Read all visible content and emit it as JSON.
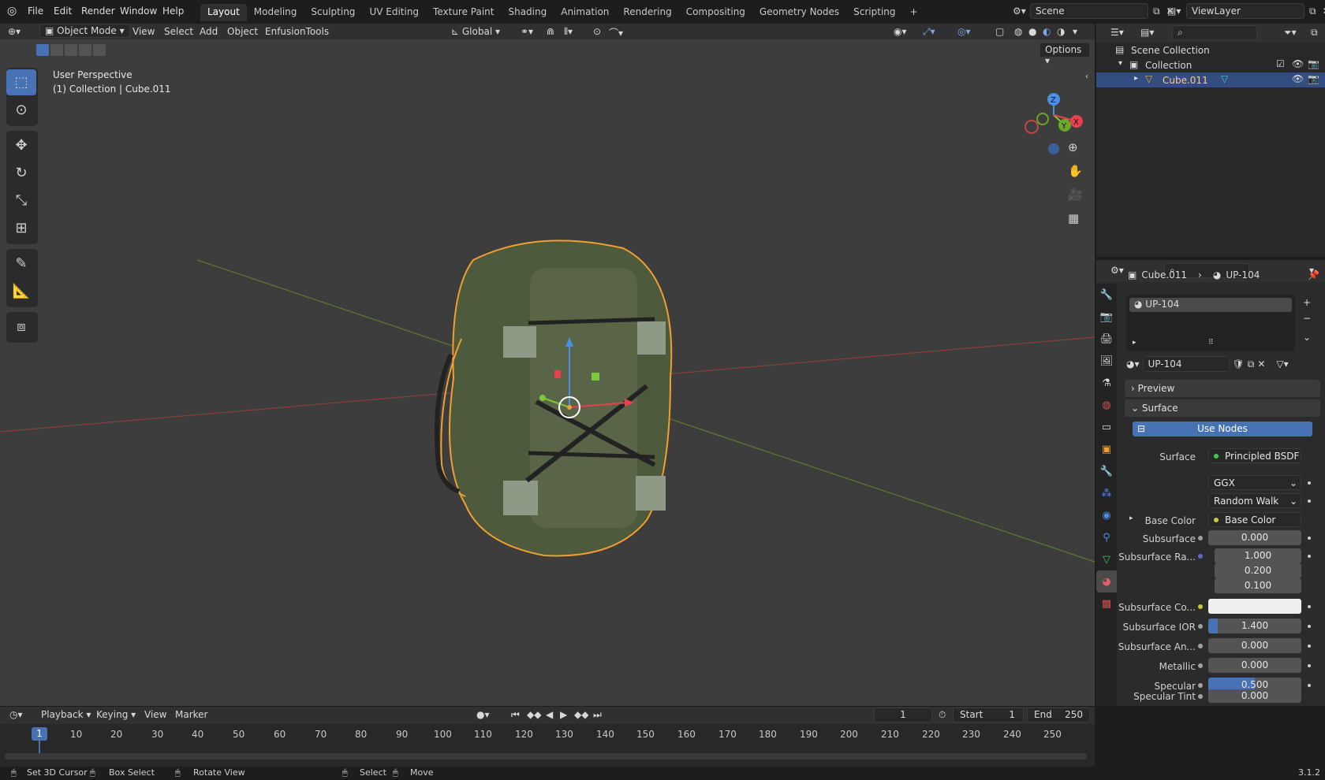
{
  "topbar": {
    "menus": [
      "File",
      "Edit",
      "Render",
      "Window",
      "Help"
    ],
    "workspaces": [
      "Layout",
      "Modeling",
      "Sculpting",
      "UV Editing",
      "Texture Paint",
      "Shading",
      "Animation",
      "Rendering",
      "Compositing",
      "Geometry Nodes",
      "Scripting"
    ],
    "active_workspace": "Layout",
    "add_tab": "+",
    "scene": "Scene",
    "view_layer": "ViewLayer"
  },
  "viewport": {
    "mode": "Object Mode",
    "menus": [
      "View",
      "Select",
      "Add",
      "Object",
      "EnfusionTools"
    ],
    "orientation": "Global",
    "options": "Options",
    "perspective": "User Perspective",
    "object_info": "(1) Collection | Cube.011",
    "gizmo": {
      "z": "Z",
      "y": "Y",
      "x": "X"
    }
  },
  "outliner": {
    "root": "Scene Collection",
    "collection": "Collection",
    "object": "Cube.011"
  },
  "properties": {
    "breadcrumb_object": "Cube.011",
    "breadcrumb_material": "UP-104",
    "slot": "UP-104",
    "material_name": "UP-104",
    "panels": {
      "preview": "Preview",
      "surface": "Surface"
    },
    "use_nodes": "Use Nodes",
    "surface_label": "Surface",
    "surface_value": "Principled BSDF",
    "distribution": "GGX",
    "subsurface_method": "Random Walk",
    "rows": [
      {
        "label": "Base Color",
        "value": "Base Color"
      },
      {
        "label": "Subsurface",
        "value": "0.000"
      },
      {
        "label": "Subsurface Ra...",
        "value": "1.000"
      },
      {
        "label": "",
        "value": "0.200"
      },
      {
        "label": "",
        "value": "0.100"
      },
      {
        "label": "Subsurface Co...",
        "value": ""
      },
      {
        "label": "Subsurface IOR",
        "value": "1.400"
      },
      {
        "label": "Subsurface An...",
        "value": "0.000"
      },
      {
        "label": "Metallic",
        "value": "0.000"
      },
      {
        "label": "Specular",
        "value": "0.500"
      },
      {
        "label": "Specular Tint",
        "value": "0.000"
      }
    ]
  },
  "timeline": {
    "menus": [
      "Playback",
      "Keying",
      "View",
      "Marker"
    ],
    "current_frame": "1",
    "start_label": "Start",
    "start": "1",
    "end_label": "End",
    "end": "250",
    "ticks": [
      "10",
      "20",
      "30",
      "40",
      "50",
      "60",
      "70",
      "80",
      "90",
      "100",
      "110",
      "120",
      "130",
      "140",
      "150",
      "160",
      "170",
      "180",
      "190",
      "200",
      "210",
      "220",
      "230",
      "240",
      "250"
    ]
  },
  "statusbar": {
    "items": [
      "Set 3D Cursor",
      "Box Select",
      "Rotate View",
      "Select",
      "Move"
    ],
    "version": "3.1.2"
  },
  "colors": {
    "accent": "#4772b3",
    "selection_outline": "#f0a030",
    "x_axis": "#c04848",
    "y_axis": "#7a9a30"
  }
}
